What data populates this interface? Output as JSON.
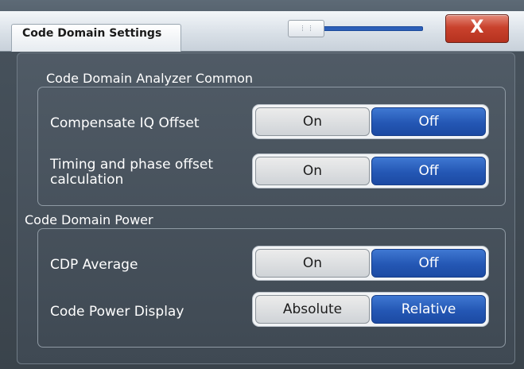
{
  "window": {
    "title": "Code Domain Settings",
    "close_label": "X"
  },
  "groups": [
    {
      "label": "Code Domain Analyzer Common",
      "rows": [
        {
          "label": "Compensate IQ Offset",
          "options": [
            "On",
            "Off"
          ],
          "selected": "Off"
        },
        {
          "label": "Timing and phase offset calculation",
          "options": [
            "On",
            "Off"
          ],
          "selected": "Off"
        }
      ]
    },
    {
      "label": "Code Domain Power",
      "rows": [
        {
          "label": "CDP Average",
          "options": [
            "On",
            "Off"
          ],
          "selected": "Off"
        },
        {
          "label": "Code Power Display",
          "options": [
            "Absolute",
            "Relative"
          ],
          "selected": "Relative"
        }
      ]
    }
  ],
  "colors": {
    "selected": "#2457b4",
    "unselected": "#dcdfe2",
    "close": "#c9422d"
  }
}
